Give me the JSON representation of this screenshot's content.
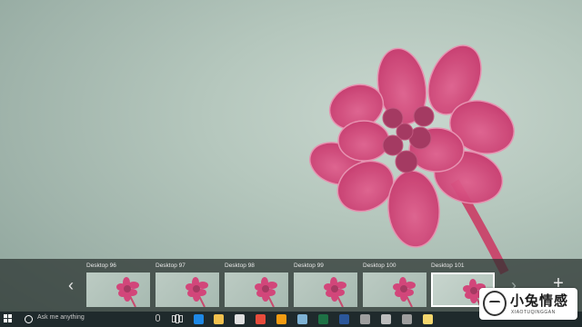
{
  "task_view": {
    "desktops": [
      {
        "label": "Desktop 96",
        "active": false
      },
      {
        "label": "Desktop 97",
        "active": false
      },
      {
        "label": "Desktop 98",
        "active": false
      },
      {
        "label": "Desktop 99",
        "active": false
      },
      {
        "label": "Desktop 100",
        "active": false
      },
      {
        "label": "Desktop 101",
        "active": true
      }
    ],
    "prev_arrow": "‹",
    "next_arrow": "›",
    "new_desktop": "+"
  },
  "taskbar": {
    "search_placeholder": "Ask me anything",
    "pinned_icons": [
      {
        "name": "edge-icon",
        "color": "#1e88e5"
      },
      {
        "name": "file-explorer-icon",
        "color": "#f2c14e"
      },
      {
        "name": "store-icon",
        "color": "#e0e0e0"
      },
      {
        "name": "chrome-icon",
        "color": "#e74c3c"
      },
      {
        "name": "firefox-icon",
        "color": "#f39c12"
      },
      {
        "name": "notepad-icon",
        "color": "#7fb3d5"
      },
      {
        "name": "excel-icon",
        "color": "#1e7145"
      },
      {
        "name": "word-icon",
        "color": "#2b579a"
      },
      {
        "name": "paint-icon",
        "color": "#9e9e9e"
      },
      {
        "name": "settings-app-icon",
        "color": "#bdbdbd"
      },
      {
        "name": "calculator-icon",
        "color": "#9e9e9e"
      },
      {
        "name": "photos-icon",
        "color": "#f5d76e"
      }
    ]
  },
  "watermark": {
    "title": "小兔情感",
    "subtitle": "XIAOTUQINGGAN"
  }
}
